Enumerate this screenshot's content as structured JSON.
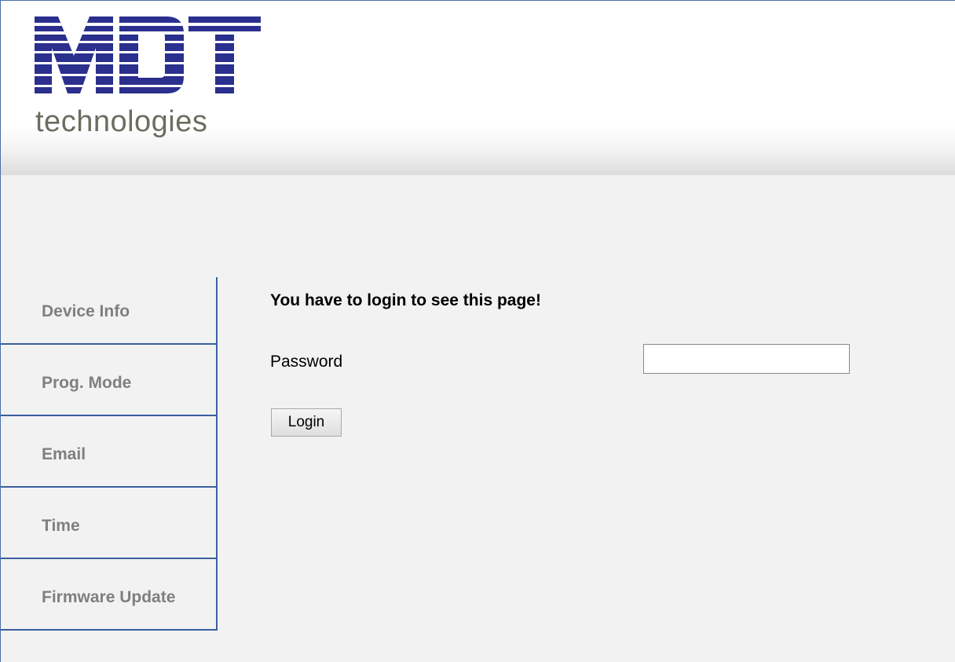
{
  "header": {
    "logo_text": "MDT",
    "logo_subtitle": "technologies",
    "logo_color": "#2b2f8e"
  },
  "nav": {
    "items": [
      {
        "label": "Device Info"
      },
      {
        "label": "Prog. Mode"
      },
      {
        "label": "Email"
      },
      {
        "label": "Time"
      },
      {
        "label": "Firmware Update"
      }
    ]
  },
  "main": {
    "message": "You have to login to see this page!",
    "password_label": "Password",
    "password_value": "",
    "login_button": "Login"
  },
  "colors": {
    "border_accent": "#3a5fa0",
    "nav_text": "#7f7f7f",
    "background": "#f2f2f2"
  }
}
